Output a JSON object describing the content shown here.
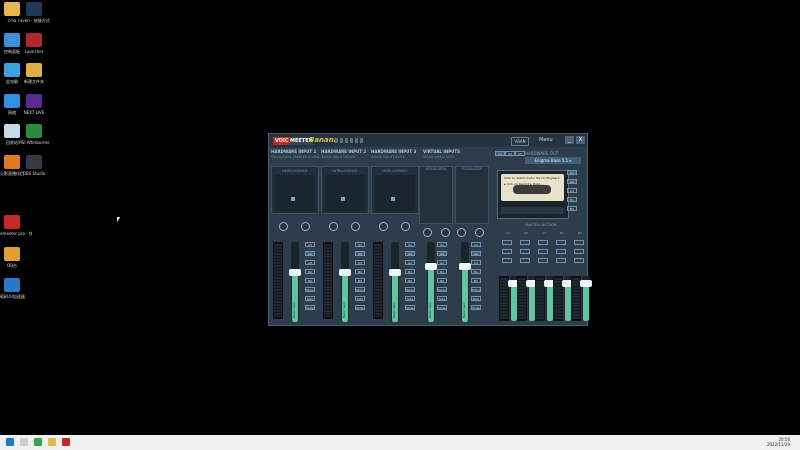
{
  "desktop": {
    "icons": [
      {
        "label": "c-ha",
        "color": "#e8b84a"
      },
      {
        "label": "raven - 快捷方式",
        "color": "#1e3a5a"
      },
      {
        "label": "控制面板",
        "color": "#3c8fd8"
      },
      {
        "label": "Launcher",
        "color": "#b0282b"
      },
      {
        "label": "此电脑",
        "color": "#3aa0e0"
      },
      {
        "label": "新建文件夹",
        "color": "#e0b040"
      },
      {
        "label": "网络",
        "color": "#2f8fe0"
      },
      {
        "label": "NEXT LIVE",
        "color": "#5b2a8f"
      },
      {
        "label": "回收站",
        "color": "#c8d8e8"
      },
      {
        "label": "MSI Afterburner",
        "color": "#2c8a3c"
      },
      {
        "label": "火影直播伴侣",
        "color": "#e07a20"
      },
      {
        "label": "OBS Studio",
        "color": "#333a44"
      },
      {
        "label": "voicemeeter pro - 快捷方式",
        "color": "#c62828"
      },
      {
        "label": "OB台",
        "color": "#e0a030"
      },
      {
        "label": "网易UU加速器",
        "color": "#2a78c8"
      }
    ]
  },
  "app": {
    "title_voice": "VOICE",
    "title_meeter": "MEETER",
    "title_banana": "Banana",
    "vban": "VBAN",
    "menu": "Menu",
    "minimize": "_",
    "close": "X",
    "strips": [
      {
        "title": "HARDWARE INPUT 1",
        "device": "Microphone (Realtek Audio)",
        "intel": "INTELLIGENCE",
        "fader": "Fader Gain"
      },
      {
        "title": "HARDWARE INPUT 2",
        "device": "Select Input Device",
        "intel": "INTELLIGENCE",
        "fader": "Fader Gain"
      },
      {
        "title": "HARDWARE INPUT 3",
        "device": "Select Input Device",
        "intel": "INTELLIGENCE",
        "fader": "Fader Gain"
      }
    ],
    "virtual": {
      "title": "VIRTUAL INPUTS",
      "sub1": "Voicemeeter VAIO",
      "sub2": "Voicemeeter AUX",
      "eq": "EQUALIZER",
      "fader": "Fader Gain"
    },
    "hw_out": {
      "a1": "A1",
      "a2": "A2",
      "a3": "A3",
      "label": "HARDWARE OUT",
      "device": "Enigma Base 5.1 ▸"
    },
    "cassette": {
      "line1": "Click to Select Audio file for Playback",
      "line2": "▸ click on Record ▸ Make ..."
    },
    "master_label": "MASTER SECTION",
    "master_strips": [
      "A1",
      "A2",
      "A3",
      "B1",
      "B2"
    ],
    "bus_buttons": [
      "A1",
      "A2",
      "A3",
      "B1",
      "B2",
      "Mono",
      "Solo",
      "Mute"
    ]
  },
  "taskbar": {
    "time": "20:56",
    "date": "2022/11/29"
  }
}
